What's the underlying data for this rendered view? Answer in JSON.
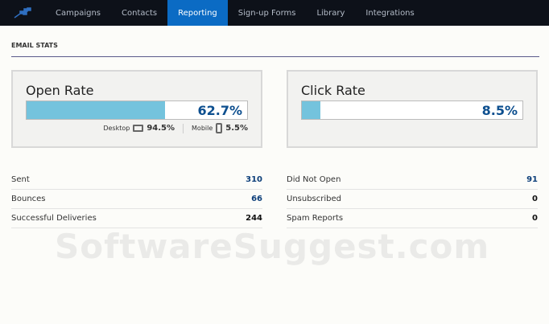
{
  "nav": {
    "items": [
      "Campaigns",
      "Contacts",
      "Reporting",
      "Sign-up Forms",
      "Library",
      "Integrations"
    ],
    "active": 2
  },
  "section_title": "EMAIL STATS",
  "open_rate": {
    "title": "Open Rate",
    "value": "62.7%",
    "fraction": 0.627,
    "desktop_label": "Desktop",
    "desktop_value": "94.5%",
    "mobile_label": "Mobile",
    "mobile_value": "5.5%"
  },
  "click_rate": {
    "title": "Click Rate",
    "value": "8.5%",
    "fraction": 0.085
  },
  "left_stats": [
    {
      "label": "Sent",
      "value": "310"
    },
    {
      "label": "Bounces",
      "value": "66"
    },
    {
      "label": "Successful Deliveries",
      "value": "244"
    }
  ],
  "right_stats": [
    {
      "label": "Did Not Open",
      "value": "91"
    },
    {
      "label": "Unsubscribed",
      "value": "0"
    },
    {
      "label": "Spam Reports",
      "value": "0"
    }
  ],
  "watermark": "SoftwareSuggest.com"
}
